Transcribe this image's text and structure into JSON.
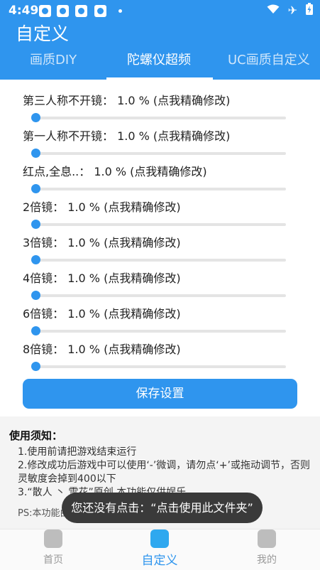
{
  "status_bar": {
    "time": "4:49"
  },
  "app_title": "自定义",
  "tabs": [
    {
      "label": "画质DIY"
    },
    {
      "label": "陀螺仪超频"
    },
    {
      "label": "UC画质自定义"
    }
  ],
  "settings": [
    {
      "label": "第三人称不开镜：  1.0 %  (点我精确修改)",
      "value_percent": 1.0
    },
    {
      "label": "第一人称不开镜：  1.0 %  (点我精确修改)",
      "value_percent": 1.0
    },
    {
      "label": "红点,全息..：  1.0 %  (点我精确修改)",
      "value_percent": 1.0
    },
    {
      "label": "2倍镜：  1.0 %  (点我精确修改)",
      "value_percent": 1.0
    },
    {
      "label": "3倍镜：  1.0 %  (点我精确修改)",
      "value_percent": 1.0
    },
    {
      "label": "4倍镜：  1.0 %  (点我精确修改)",
      "value_percent": 1.0
    },
    {
      "label": "6倍镜：  1.0 %  (点我精确修改)",
      "value_percent": 1.0
    },
    {
      "label": "8倍镜：  1.0 %  (点我精确修改)",
      "value_percent": 1.0
    }
  ],
  "save_button": "保存设置",
  "notice": {
    "title": "使用须知：",
    "lines": [
      "1.使用前请把游戏结束运行",
      "2.修改成功后游戏中可以使用‘-’微调，请勿点‘+’或拖动调节，否则灵敏度会掉到400以下",
      "3.“散人 丶 雪花”原创,本功能仅供娱乐"
    ],
    "ps": "PS:本功能由国外陀螺仪不完整制作作者许可调整优"
  },
  "toast": "您还没有点击：“点击使用此文件夹”",
  "bottom_nav": [
    {
      "label": "首页",
      "icon": "home-icon"
    },
    {
      "label": "自定义",
      "icon": "custom-icon"
    },
    {
      "label": "我的",
      "icon": "profile-icon"
    }
  ],
  "colors": {
    "primary": "#2f95ee",
    "toast_bg": "#3a3a3a"
  }
}
